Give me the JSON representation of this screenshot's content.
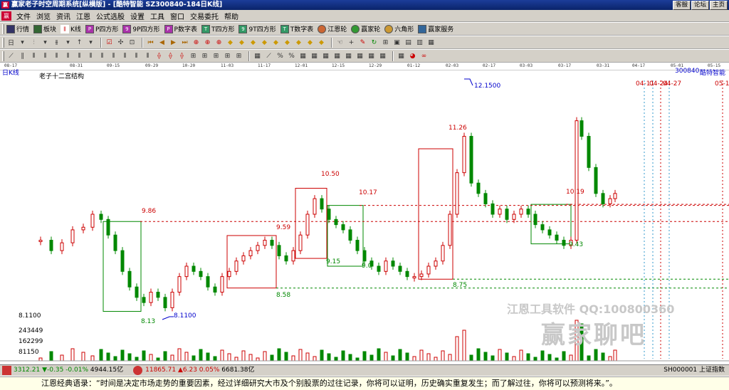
{
  "window": {
    "title": "赢家老子时空周期系统[纵横版] - [酷特智能  SZ300840-184日K线]",
    "buttons": [
      "客服",
      "论坛",
      "主页"
    ]
  },
  "menu": {
    "items": [
      "文件",
      "浏览",
      "资讯",
      "江恩",
      "公式选股",
      "设置",
      "工具",
      "窗口",
      "交易委托",
      "帮助"
    ]
  },
  "toolbar1": {
    "items": [
      {
        "label": "行情",
        "icon": "grid-icon"
      },
      {
        "label": "板块",
        "icon": "blocks-icon"
      },
      {
        "label": "K线",
        "icon": "kline-icon"
      },
      {
        "label": "P四方形",
        "icon": "p-square-icon"
      },
      {
        "label": "9P四方形",
        "icon": "9p-square-icon"
      },
      {
        "label": "P数字表",
        "icon": "p-table-icon"
      },
      {
        "label": "T四方形",
        "icon": "t-square-icon"
      },
      {
        "label": "9T四方形",
        "icon": "9t-square-icon"
      },
      {
        "label": "T数字表",
        "icon": "t-table-icon"
      },
      {
        "label": "江恩轮",
        "icon": "gann-wheel-icon"
      },
      {
        "label": "赢家轮",
        "icon": "winner-wheel-icon"
      },
      {
        "label": "六角形",
        "icon": "hexagon-icon"
      },
      {
        "label": "赢家服务",
        "icon": "service-icon"
      }
    ]
  },
  "chart_header": {
    "period": "日K线",
    "name": "老子十二宫结构",
    "code": "300840",
    "stock": "酷特智能"
  },
  "date_axis": [
    "08-17",
    "08-31",
    "09-15",
    "09-29",
    "10-20",
    "11-03",
    "11-17",
    "12-01",
    "12-15",
    "12-29",
    "01-12",
    "02-03",
    "02-17",
    "03-03",
    "03-17",
    "03-31",
    "04-17",
    "05-01",
    "05-15"
  ],
  "annotations": {
    "prices": [
      "9.86",
      "9.59",
      "10.50",
      "10.17",
      "11.26",
      "12.1500",
      "10.19",
      "8.13",
      "8.1100",
      "8.58",
      "9.15",
      "9.0",
      "8.75",
      "9.43"
    ],
    "dates": [
      "04-11",
      "04-24",
      "04-27",
      "05-1"
    ],
    "left_price": "8.1100"
  },
  "chart_data": {
    "type": "candlestick",
    "title": "老子十二宫结构",
    "y_marks": [
      8.11,
      8.13,
      8.58,
      8.75,
      9.0,
      9.15,
      9.43,
      9.59,
      9.86,
      10.17,
      10.19,
      10.5,
      11.26,
      12.15
    ],
    "volume_axis": [
      "243449",
      "162299",
      "81150"
    ]
  },
  "watermark": {
    "line1": "江恩工具软件  QQ:100800360",
    "line2": "赢家聊吧"
  },
  "status": {
    "sh_index": "3312.21",
    "sh_change": "▼-0.35",
    "sh_pct": "-0.01%",
    "sh_amount": "4944.15亿",
    "sz_index": "11865.71",
    "sz_change": "▲6.23",
    "sz_pct": "0.05%",
    "sz_amount": "6681.38亿",
    "code_right": "SH000001 上证指数"
  },
  "quote": {
    "text": "江恩经典语录：“时间是决定市场走势的重要因素，经过详细研究大市及个别股票的过往记录，你将可以证明，历史确实重复发生；而了解过往，你将可以预测将来。”。"
  }
}
